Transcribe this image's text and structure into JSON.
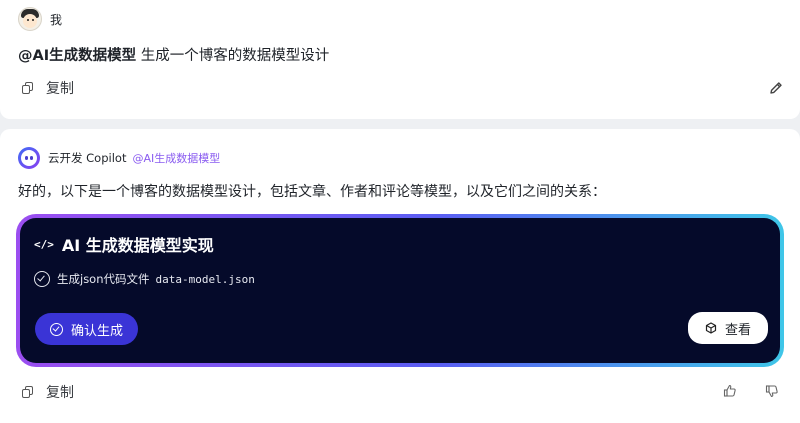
{
  "user_message": {
    "sender_name": "我",
    "mention": "@AI生成数据模型",
    "text": "生成一个博客的数据模型设计",
    "copy_label": "复制"
  },
  "bot_message": {
    "bot_name": "云开发 Copilot",
    "mention": "@AI生成数据模型",
    "text": "好的，以下是一个博客的数据模型设计，包括文章、作者和评论等模型，以及它们之间的关系：",
    "copy_label": "复制",
    "model_card": {
      "code_icon_glyph": "</>",
      "title": "AI 生成数据模型实现",
      "file_label": "生成json代码文件",
      "file_name": "data-model.json",
      "confirm_label": "确认生成",
      "view_label": "查看"
    }
  },
  "icons": [
    "avatar",
    "copy-icon",
    "edit-icon",
    "bot-avatar",
    "code-icon",
    "check-circle-icon",
    "confirm-check-icon",
    "cube-icon",
    "thumbs-up-icon",
    "thumbs-down-icon"
  ],
  "colors": {
    "page_background": "#eef0f3",
    "card_background": "#ffffff",
    "model_card_background": "#050a2a",
    "gradient_start": "#9b4ef0",
    "gradient_end": "#3fc6e8",
    "confirm_button": "#3a34d6",
    "mention_color": "#8a5cf0"
  }
}
